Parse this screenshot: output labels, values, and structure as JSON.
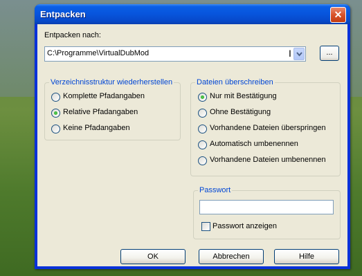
{
  "window": {
    "title": "Entpacken",
    "close_symbol": "✕"
  },
  "extract": {
    "label": "Entpacken nach:",
    "path_value": "C:\\Programme\\VirtualDubMod",
    "browse_label": "..."
  },
  "folder_structure": {
    "title": "Verzeichnisstruktur wiederherstellen",
    "options": [
      {
        "label": "Komplette Pfadangaben",
        "selected": false
      },
      {
        "label": "Relative Pfadangaben",
        "selected": true
      },
      {
        "label": "Keine Pfadangaben",
        "selected": false
      }
    ]
  },
  "overwrite": {
    "title": "Dateien überschreiben",
    "options": [
      {
        "label": "Nur mit Bestätigung",
        "selected": true
      },
      {
        "label": "Ohne Bestätigung",
        "selected": false
      },
      {
        "label": "Vorhandene Dateien überspringen",
        "selected": false
      },
      {
        "label": "Automatisch umbenennen",
        "selected": false
      },
      {
        "label": "Vorhandene Dateien umbenennen",
        "selected": false
      }
    ]
  },
  "password": {
    "title": "Passwort",
    "value": "",
    "show_label": "Passwort anzeigen",
    "show_checked": false
  },
  "buttons": {
    "ok": "OK",
    "cancel": "Abbrechen",
    "help": "Hilfe"
  },
  "colors": {
    "titlebar": "#0754dc",
    "group_title": "#0046d5",
    "dialog_bg": "#ece9d8"
  }
}
